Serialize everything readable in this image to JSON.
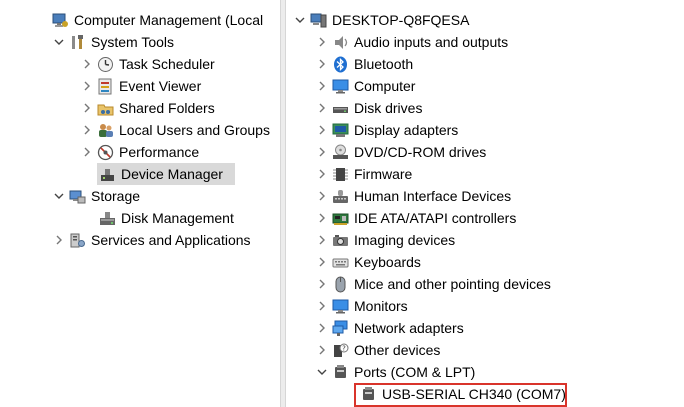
{
  "left_tree": {
    "root": "Computer Management (Local",
    "system_tools": "System Tools",
    "task_scheduler": "Task Scheduler",
    "event_viewer": "Event Viewer",
    "shared_folders": "Shared Folders",
    "local_users": "Local Users and Groups",
    "performance": "Performance",
    "device_manager": "Device Manager",
    "storage": "Storage",
    "disk_management": "Disk Management",
    "services": "Services and Applications"
  },
  "right_tree": {
    "root": "DESKTOP-Q8FQESA",
    "categories": [
      "Audio inputs and outputs",
      "Bluetooth",
      "Computer",
      "Disk drives",
      "Display adapters",
      "DVD/CD-ROM drives",
      "Firmware",
      "Human Interface Devices",
      "IDE ATA/ATAPI controllers",
      "Imaging devices",
      "Keyboards",
      "Mice and other pointing devices",
      "Monitors",
      "Network adapters",
      "Other devices",
      "Ports (COM & LPT)"
    ],
    "port_device": "USB-SERIAL CH340 (COM7)"
  },
  "colors": {
    "selection": "#d9d9d9",
    "highlight_border": "#d9342b",
    "bluetooth": "#1f6fd1"
  }
}
